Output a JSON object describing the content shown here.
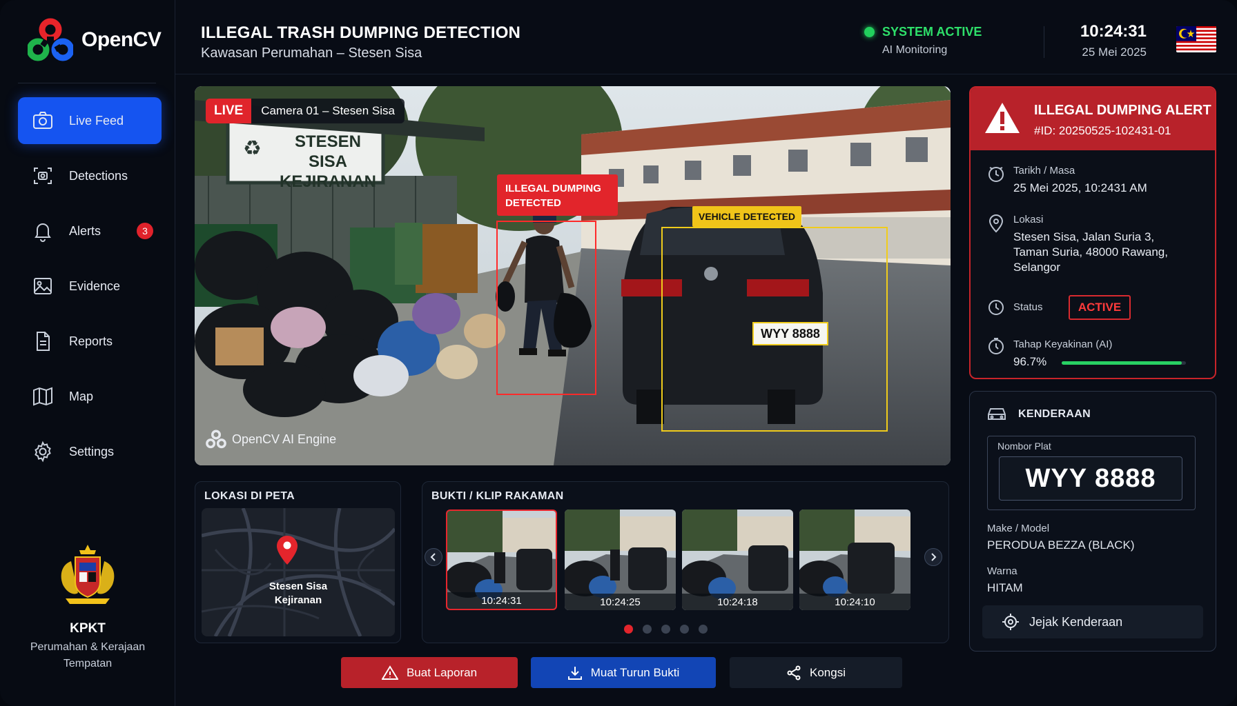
{
  "brand": {
    "name": "OpenCV"
  },
  "sidebar": {
    "items": [
      {
        "label": "Live Feed",
        "icon": "camera-icon",
        "active": true
      },
      {
        "label": "Detections",
        "icon": "scan-icon"
      },
      {
        "label": "Alerts",
        "icon": "bell-icon",
        "badge": "3"
      },
      {
        "label": "Evidence",
        "icon": "image-icon"
      },
      {
        "label": "Reports",
        "icon": "document-icon"
      },
      {
        "label": "Map",
        "icon": "map-icon"
      },
      {
        "label": "Settings",
        "icon": "gear-icon"
      }
    ],
    "org": {
      "name": "KPKT",
      "line1": "Perumahan & Kerajaan",
      "line2": "Tempatan"
    }
  },
  "header": {
    "title": "ILLEGAL TRASH DUMPING DETECTION",
    "subtitle": "Kawasan Perumahan – Stesen Sisa",
    "system_status": "SYSTEM ACTIVE",
    "system_sub": "AI Monitoring",
    "time": "10:24:31",
    "date": "25 Mei 2025"
  },
  "camera": {
    "live_label": "LIVE",
    "name": "Camera 01 – Stesen Sisa",
    "sign_line1": "STESEN SISA",
    "sign_line2": "KEJIRANAN",
    "dumping_label_1": "ILLEGAL DUMPING",
    "dumping_label_2": "DETECTED",
    "vehicle_label": "VEHICLE DETECTED",
    "plate": "WYY 8888",
    "engine": "OpenCV AI Engine"
  },
  "map_panel": {
    "title": "LOKASI DI PETA",
    "place_line1": "Stesen Sisa",
    "place_line2": "Kejiranan"
  },
  "evidence": {
    "title": "BUKTI / KLIP RAKAMAN",
    "clips": [
      {
        "time": "10:24:31",
        "selected": true
      },
      {
        "time": "10:24:25"
      },
      {
        "time": "10:24:18"
      },
      {
        "time": "10:24:10"
      }
    ],
    "page": 1,
    "pages": 5
  },
  "actions": {
    "report": "Buat Laporan",
    "download": "Muat Turun Bukti",
    "share": "Kongsi"
  },
  "alert": {
    "title": "ILLEGAL DUMPING ALERT",
    "id": "#ID: 20250525-102431-01",
    "datetime_label": "Tarikh / Masa",
    "datetime": "25 Mei 2025, 10:2431 AM",
    "location_label": "Lokasi",
    "location_1": "Stesen Sisa, Jalan Suria 3,",
    "location_2": "Taman Suria, 48000 Rawang,",
    "location_3": "Selangor",
    "status_label": "Status",
    "status": "ACTIVE",
    "confidence_label": "Tahap Keyakinan (AI)",
    "confidence": "96.7%",
    "confidence_value": 96.7
  },
  "vehicle": {
    "title": "KENDERAAN",
    "plate_label": "Nombor Plat",
    "plate": "WYY 8888",
    "model_label": "Make / Model",
    "model": "PERODUA BEZZA (BLACK)",
    "color_label": "Warna",
    "color": "HITAM",
    "track": "Jejak Kenderaan"
  },
  "colors": {
    "accent_blue": "#1554f0",
    "alert_red": "#e0242b",
    "ok_green": "#22d05d",
    "detect_yellow": "#f0c419"
  }
}
